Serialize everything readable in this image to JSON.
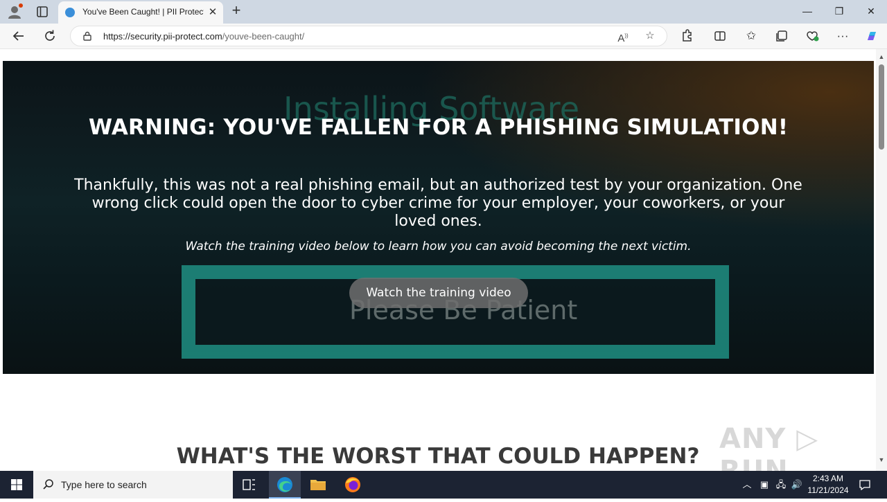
{
  "browser": {
    "tab_title": "You've Been Caught! | PII Protect",
    "url_host": "https://security.pii-protect.com",
    "url_path": "/youve-been-caught/"
  },
  "hero": {
    "background_text_1": "Installing Software",
    "background_text_2": "Please Be Patient",
    "title": "WARNING: YOU'VE FALLEN FOR A PHISHING SIMULATION!",
    "body": "Thankfully, this was not a real phishing email, but an authorized test by your organization. One wrong click could open the door to cyber crime for your employer, your coworkers, or your loved ones.",
    "subtitle": "Watch the training video below to learn how you can avoid becoming the next victim.",
    "cta_label": "Watch the training video"
  },
  "section": {
    "title": "WHAT'S THE WORST THAT COULD HAPPEN?"
  },
  "watermark": "ANY RUN",
  "taskbar": {
    "search_placeholder": "Type here to search",
    "time": "2:43 AM",
    "date": "11/21/2024"
  },
  "colors": {
    "tabbar_bg": "#cfd8e3",
    "toolbar_bg": "#f7f7f7",
    "hero_accent": "#1f8f82",
    "taskbar_bg": "#1c2333"
  },
  "icons": [
    "profile-icon",
    "tab-actions-icon",
    "reload-icon",
    "back-icon",
    "lock-icon",
    "read-aloud-icon",
    "favorite-star-icon",
    "extensions-icon",
    "split-screen-icon",
    "favorites-icon",
    "collections-icon",
    "browser-essentials-icon",
    "more-icon",
    "copilot-icon",
    "windows-start-icon",
    "search-icon",
    "task-view-icon",
    "edge-icon",
    "file-explorer-icon",
    "firefox-icon"
  ]
}
